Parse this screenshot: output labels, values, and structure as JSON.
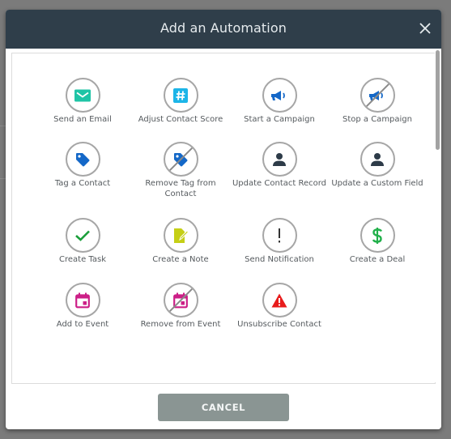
{
  "modal": {
    "title": "Add an Automation",
    "close_icon": "close-icon",
    "cancel_label": "CANCEL"
  },
  "actions": [
    {
      "label": "Send an Email",
      "icon": "envelope-icon",
      "color": "#1fc4a6",
      "disabled_slash": false
    },
    {
      "label": "Adjust Contact Score",
      "icon": "hashtag-icon",
      "color": "#1cb5e8",
      "disabled_slash": false
    },
    {
      "label": "Start a Campaign",
      "icon": "megaphone-icon",
      "color": "#1468c8",
      "disabled_slash": false
    },
    {
      "label": "Stop a Campaign",
      "icon": "megaphone-icon",
      "color": "#1468c8",
      "disabled_slash": true
    },
    {
      "label": "Tag a Contact",
      "icon": "tag-icon",
      "color": "#1468c8",
      "disabled_slash": false
    },
    {
      "label": "Remove Tag from Contact",
      "icon": "tag-icon",
      "color": "#1468c8",
      "disabled_slash": true
    },
    {
      "label": "Update Contact Record",
      "icon": "person-icon",
      "color": "#2d3b48",
      "disabled_slash": false
    },
    {
      "label": "Update a Custom Field",
      "icon": "person-icon",
      "color": "#2d3b48",
      "disabled_slash": false
    },
    {
      "label": "Create Task",
      "icon": "checkmark-icon",
      "color": "#1a9e3a",
      "disabled_slash": false
    },
    {
      "label": "Create a Note",
      "icon": "note-icon",
      "color": "#c5cf16",
      "disabled_slash": false
    },
    {
      "label": "Send Notification",
      "icon": "exclamation-icon",
      "color": "#333333",
      "disabled_slash": false
    },
    {
      "label": "Create a Deal",
      "icon": "dollar-icon",
      "color": "#21b04a",
      "disabled_slash": false
    },
    {
      "label": "Add to Event",
      "icon": "calendar-icon",
      "color": "#cc1f87",
      "disabled_slash": false
    },
    {
      "label": "Remove from Event",
      "icon": "calendar-icon",
      "color": "#cc1f87",
      "disabled_slash": true
    },
    {
      "label": "Unsubscribe Contact",
      "icon": "warning-icon",
      "color": "#e81c1c",
      "disabled_slash": false
    }
  ]
}
